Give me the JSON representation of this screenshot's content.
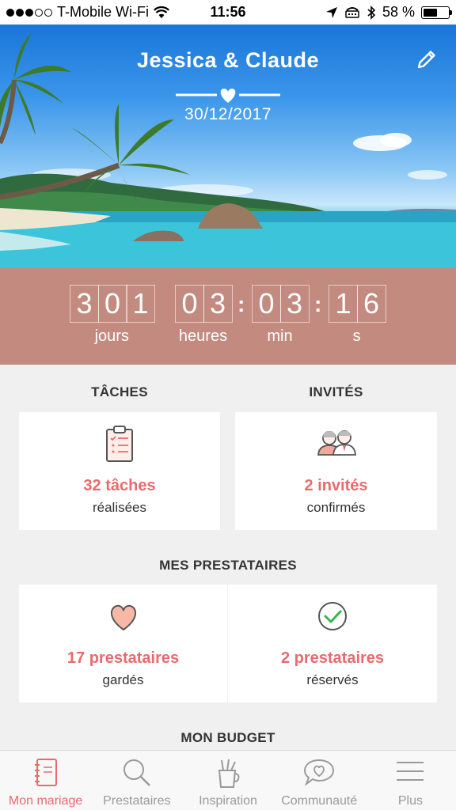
{
  "status_bar": {
    "carrier": "T-Mobile Wi-Fi",
    "time": "11:56",
    "battery": "58 %",
    "battery_level": 0.58
  },
  "header": {
    "couple": "Jessica & Claude",
    "date": "30/12/2017"
  },
  "countdown": {
    "days": [
      "3",
      "0",
      "1"
    ],
    "hours": [
      "0",
      "3"
    ],
    "minutes": [
      "0",
      "3"
    ],
    "seconds": [
      "1",
      "6"
    ],
    "labels": {
      "days": "jours",
      "hours": "heures",
      "minutes": "min",
      "seconds": "s"
    }
  },
  "tasks": {
    "title": "TÂCHES",
    "value": "32 tâches",
    "sub": "réalisées"
  },
  "guests": {
    "title": "INVITÉS",
    "value": "2 invités",
    "sub": "confirmés"
  },
  "vendors": {
    "title": "MES PRESTATAIRES",
    "kept": {
      "value": "17 prestataires",
      "sub": "gardés"
    },
    "booked": {
      "value": "2 prestataires",
      "sub": "réservés"
    }
  },
  "budget": {
    "title": "MON BUDGET"
  },
  "tabs": [
    {
      "label": "Mon mariage",
      "icon": "notebook-icon",
      "active": true
    },
    {
      "label": "Prestataires",
      "icon": "search-icon",
      "active": false
    },
    {
      "label": "Inspiration",
      "icon": "pencil-cup-icon",
      "active": false
    },
    {
      "label": "Communauté",
      "icon": "chat-heart-icon",
      "active": false
    },
    {
      "label": "Plus",
      "icon": "menu-icon",
      "active": false
    }
  ],
  "colors": {
    "accent": "#e96a6d",
    "countdown_bg": "#c38a80",
    "background": "#f0f0f0"
  }
}
